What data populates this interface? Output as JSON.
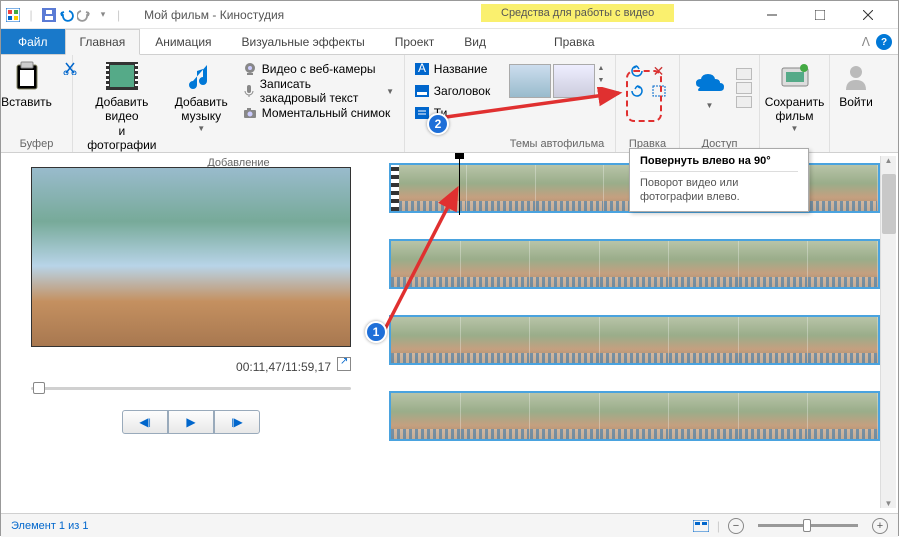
{
  "title": "Мой фильм - Киностудия",
  "context_tab_header": "Средства для работы с видео",
  "tabs": {
    "file": "Файл",
    "home": "Главная",
    "animation": "Анимация",
    "effects": "Визуальные эффекты",
    "project": "Проект",
    "view": "Вид",
    "edit": "Правка"
  },
  "ribbon": {
    "buffer": {
      "paste": "Вставить",
      "label": "Буфер"
    },
    "add": {
      "add_video": "Добавить видео\nи фотографии",
      "add_music": "Добавить\nмузыку",
      "webcam": "Видео с веб-камеры",
      "narration": "Записать закадровый текст",
      "snapshot": "Моментальный снимок",
      "label": "Добавление"
    },
    "text": {
      "title": "Название",
      "caption": "Заголовок",
      "credits": "Ти..."
    },
    "themes": {
      "label": "Темы автофильма"
    },
    "editing": {
      "label": "Правка"
    },
    "share": {
      "save": "Сохранить\nфильм",
      "signin": "Войти",
      "label": "Доступ"
    }
  },
  "preview": {
    "time": "00:11,47/11:59,17"
  },
  "status": {
    "element": "Элемент 1 из 1"
  },
  "tooltip": {
    "title": "Повернуть влево на 90°",
    "body": "Поворот видео или фотографии влево."
  },
  "callouts": {
    "one": "1",
    "two": "2"
  }
}
